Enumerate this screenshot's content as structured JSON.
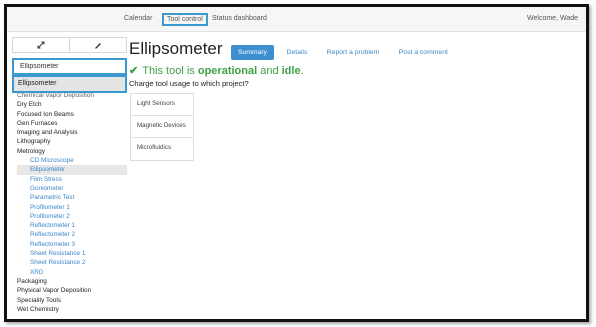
{
  "navbar": {
    "links": [
      "Calendar",
      "Tool control",
      "Status dashboard"
    ],
    "active": "Tool control",
    "welcome": "Welcome, Wade"
  },
  "sidebar": {
    "search_value": "Ellipsometer",
    "suggestion": "Ellipsometer",
    "expand_icon": "expand-arrows-icon",
    "edit_icon": "pencil-icon",
    "categories": [
      {
        "label": "Chemical Vapor Deposition",
        "faded": true
      },
      {
        "label": "Dry Etch"
      },
      {
        "label": "Focused Ion Beams"
      },
      {
        "label": "Gen Furnaces"
      },
      {
        "label": "Imaging and Analysis"
      },
      {
        "label": "Lithography"
      },
      {
        "label": "Metrology"
      }
    ],
    "metrology_tools": [
      "CD Microscope",
      "Ellipsometer",
      "Film Stress",
      "Goniometer",
      "Parametric Test",
      "Profilometer 1",
      "Profilometer 2",
      "Reflectometer 1",
      "Reflectometer 2",
      "Reflectometer 3",
      "Sheet Resistance 1",
      "Sheet Resistance 2",
      "XRD"
    ],
    "selected_tool": "Ellipsometer",
    "categories_after": [
      "Packaging",
      "Physical Vapor Deposition",
      "Speciality Tools",
      "Wet Chemistry"
    ]
  },
  "main": {
    "title": "Ellipsometer",
    "tabs": [
      "Summary",
      "Details",
      "Report a problem",
      "Post a comment"
    ],
    "active_tab": "Summary",
    "status_prefix": "This tool is ",
    "status_operational": "operational",
    "status_and": " and ",
    "status_idle": "idle",
    "status_suffix": ".",
    "question": "Charge tool usage to which project?",
    "projects": [
      "Light Sensors",
      "Magnetic Devices",
      "Microfluidics"
    ]
  },
  "colors": {
    "accent": "#3a9ad0",
    "link": "#3a86c8",
    "tab_active_bg": "#3e8fd0",
    "status_green": "#3fa046"
  }
}
